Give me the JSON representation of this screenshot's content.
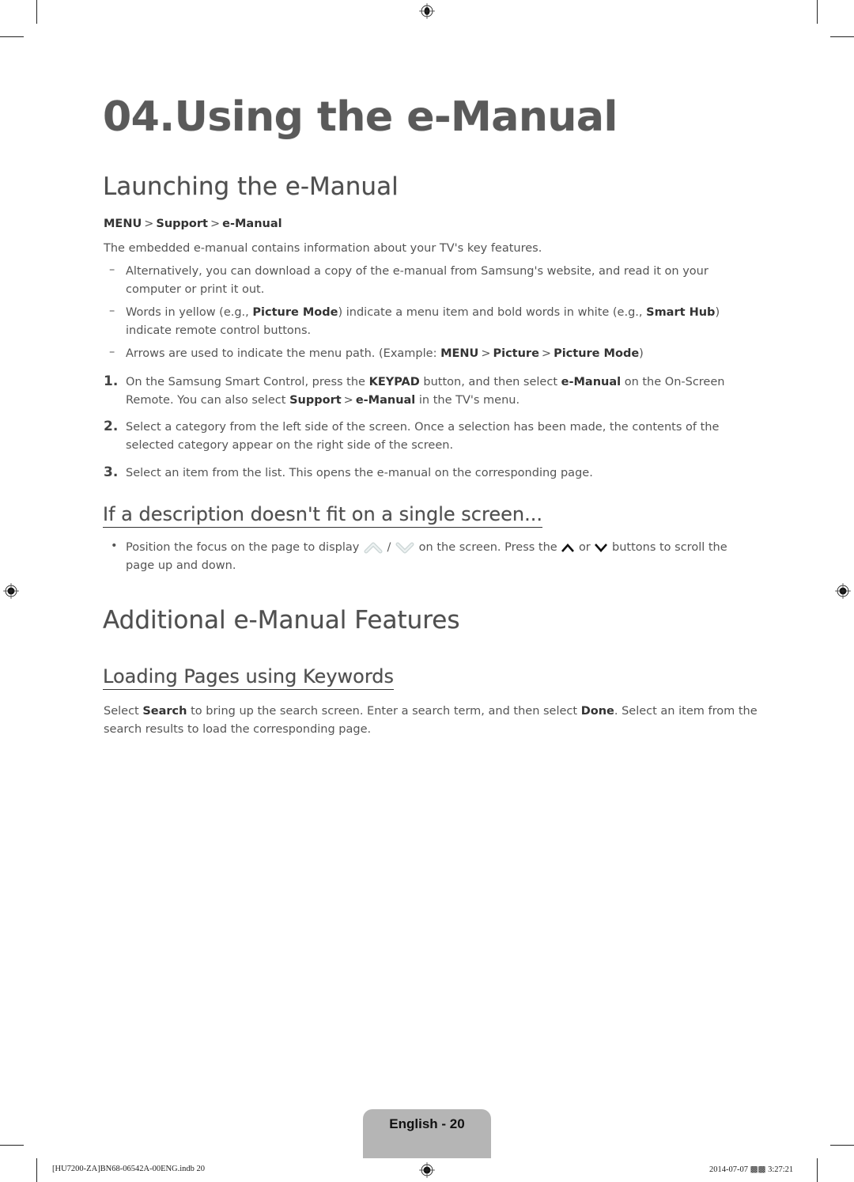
{
  "document": {
    "chapter_title": "04.Using the e-Manual",
    "section_launching": {
      "title": "Launching the e-Manual",
      "menu_path": [
        "MENU",
        "Support",
        "e-Manual"
      ],
      "intro": "The embedded e-manual contains information about your TV's key features.",
      "notes": [
        {
          "parts": [
            {
              "t": "Alternatively, you can download a copy of the e-manual from Samsung's website, and read it on your computer or print it out."
            }
          ]
        },
        {
          "parts": [
            {
              "t": "Words in yellow (e.g., "
            },
            {
              "t": "Picture Mode",
              "b": true
            },
            {
              "t": ") indicate a menu item and bold words in white (e.g., "
            },
            {
              "t": "Smart Hub",
              "b": true
            },
            {
              "t": ") indicate remote control buttons."
            }
          ]
        },
        {
          "parts": [
            {
              "t": "Arrows are used to indicate the menu path. (Example: "
            },
            {
              "t": "MENU",
              "b": true
            },
            {
              "t": ">",
              "sep": true
            },
            {
              "t": "Picture",
              "b": true
            },
            {
              "t": ">",
              "sep": true
            },
            {
              "t": "Picture Mode",
              "b": true
            },
            {
              "t": ")"
            }
          ]
        }
      ],
      "steps": [
        {
          "number": "1.",
          "parts": [
            {
              "t": "On the Samsung Smart Control, press the "
            },
            {
              "t": "KEYPAD",
              "b": true
            },
            {
              "t": " button, and then select "
            },
            {
              "t": "e-Manual",
              "b": true
            },
            {
              "t": " on the On-Screen Remote. You can also select "
            },
            {
              "t": "Support",
              "b": true
            },
            {
              "t": ">",
              "sep": true
            },
            {
              "t": "e-Manual",
              "b": true
            },
            {
              "t": " in the TV's menu."
            }
          ]
        },
        {
          "number": "2.",
          "parts": [
            {
              "t": "Select a category from the left side of the screen. Once a selection has been made, the contents of the selected category appear on the right side of the screen."
            }
          ]
        },
        {
          "number": "3.",
          "parts": [
            {
              "t": "Select an item from the list. This opens the e-manual on the corresponding page."
            }
          ]
        }
      ]
    },
    "section_single_screen": {
      "title": "If a description doesn't fit on a single screen...",
      "bullet_before_icons": "Position the focus on the page to display",
      "icon_separator": "/",
      "bullet_mid": "on the screen. Press the",
      "bullet_or": "or",
      "bullet_after": "buttons to scroll the page up and down.",
      "icons": [
        "page-up-icon",
        "page-down-icon",
        "caret-up-icon",
        "caret-down-icon"
      ]
    },
    "section_additional": {
      "title": "Additional e-Manual Features",
      "subsection_title": "Loading Pages using Keywords",
      "parts": [
        {
          "t": "Select "
        },
        {
          "t": "Search",
          "b": true
        },
        {
          "t": " to bring up the search screen. Enter a search term, and then select "
        },
        {
          "t": "Done",
          "b": true
        },
        {
          "t": ". Select an item from the search results to load the corresponding page."
        }
      ]
    }
  },
  "footer": {
    "page_label": "English - 20",
    "slug_left": "[HU7200-ZA]BN68-06542A-00ENG.indb   20",
    "slug_right": "2014-07-07   ▩▩ 3:27:21"
  },
  "colors": {
    "heading": "#5a5a5a",
    "body": "#555555",
    "page_tab": "#b5b5b5"
  }
}
